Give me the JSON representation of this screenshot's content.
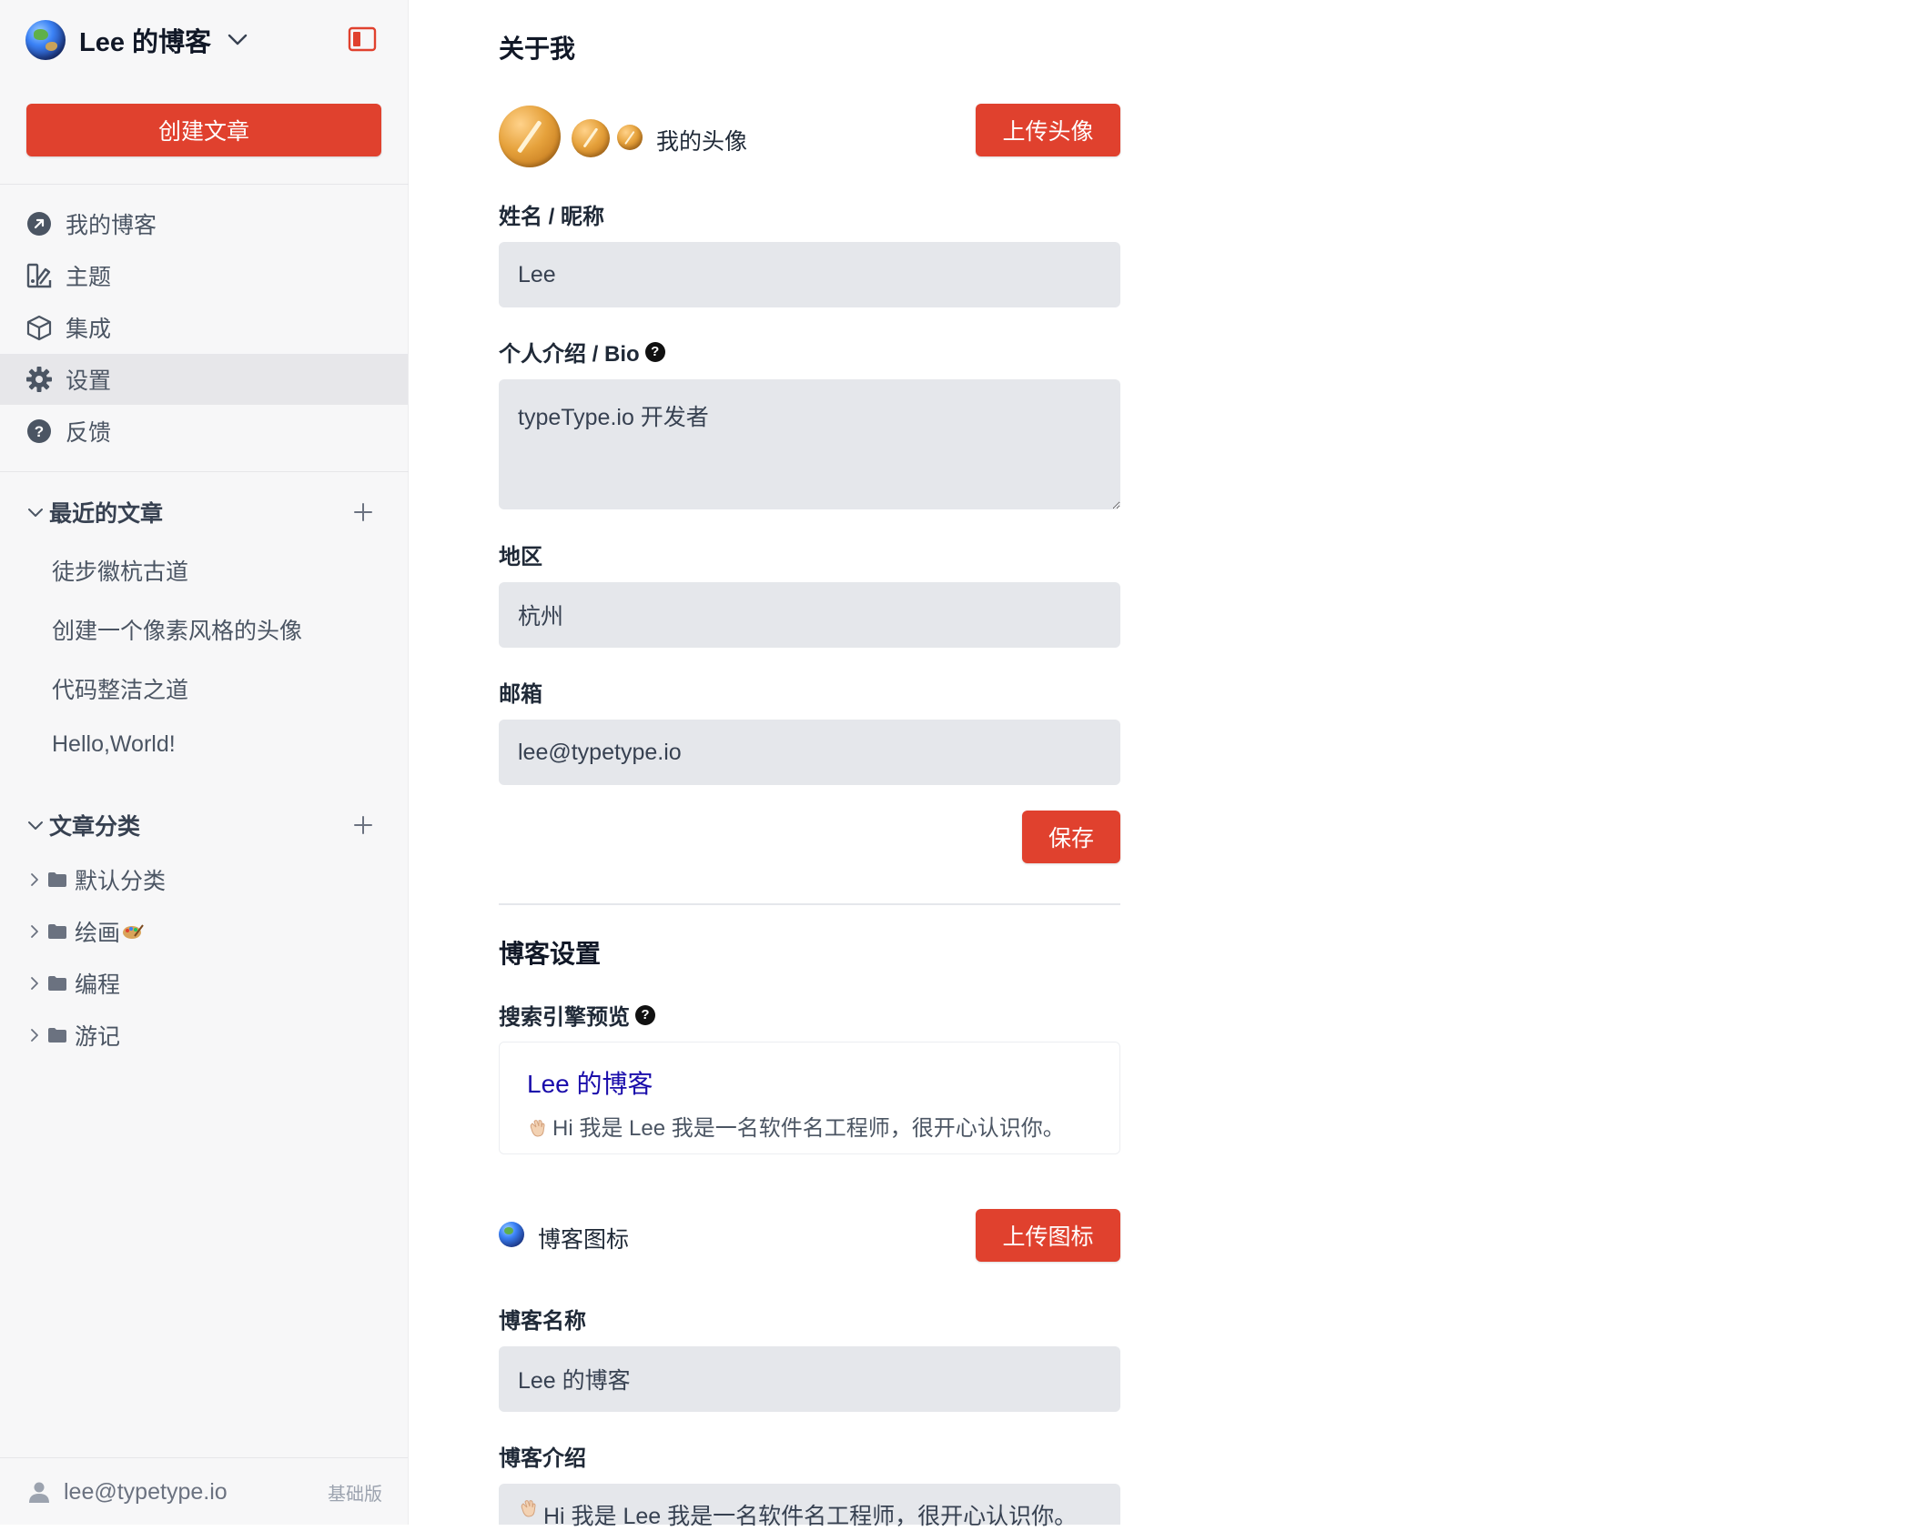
{
  "sidebar": {
    "blog_name": "Lee 的博客",
    "create_label": "创建文章",
    "nav": [
      {
        "label": "我的博客",
        "icon": "external-link-icon"
      },
      {
        "label": "主题",
        "icon": "theme-icon"
      },
      {
        "label": "集成",
        "icon": "cube-icon"
      },
      {
        "label": "设置",
        "icon": "gear-icon",
        "active": true
      },
      {
        "label": "反馈",
        "icon": "question-icon"
      }
    ],
    "recent": {
      "title": "最近的文章",
      "posts": [
        "徒步徽杭古道",
        "创建一个像素风格的头像",
        "代码整洁之道",
        "Hello,World!"
      ]
    },
    "categories": {
      "title": "文章分类",
      "items": [
        "默认分类",
        "绘画",
        "编程",
        "游记"
      ]
    },
    "footer": {
      "email": "lee@typetype.io",
      "plan": "基础版"
    }
  },
  "about": {
    "title": "关于我",
    "avatar_label": "我的头像",
    "upload_avatar": "上传头像",
    "name_label": "姓名 / 昵称",
    "name_value": "Lee",
    "bio_label": "个人介绍 / Bio",
    "bio_value": "typeType.io 开发者",
    "region_label": "地区",
    "region_value": "杭州",
    "email_label": "邮箱",
    "email_value": "lee@typetype.io",
    "save": "保存"
  },
  "blog_settings": {
    "title": "博客设置",
    "seo_label": "搜索引擎预览",
    "seo_title": "Lee 的博客",
    "seo_desc": "Hi 我是 Lee 我是一名软件名工程师，很开心认识你。",
    "icon_label": "博客图标",
    "upload_icon": "上传图标",
    "blog_name_label": "博客名称",
    "blog_name_value": "Lee 的博客",
    "blog_intro_label": "博客介绍",
    "blog_intro_value": "Hi 我是 Lee 我是一名软件名工程师，很开心认识你。"
  },
  "colors": {
    "accent": "#e0412e",
    "sidebar_bg": "#f7f7f8",
    "input_bg": "#e5e7eb",
    "seo_link": "#1a0dab"
  }
}
